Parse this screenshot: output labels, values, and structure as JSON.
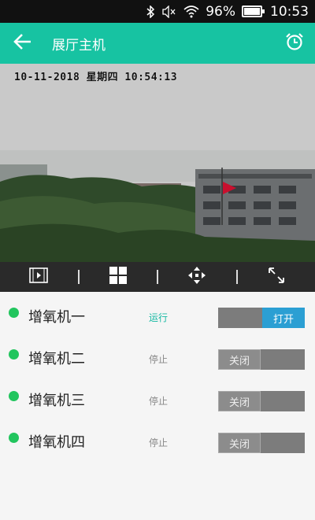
{
  "status_bar": {
    "battery": "96%",
    "time": "10:53",
    "icons": [
      "bluetooth-icon",
      "mute-icon",
      "wifi-icon",
      "battery-icon"
    ]
  },
  "app_bar": {
    "title": "展厅主机",
    "left_icon": "back-arrow-icon",
    "right_icon": "alarm-clock-icon",
    "background_color": "#17c3a2"
  },
  "camera": {
    "osd_text": "10-11-2018 星期四 10:54:13"
  },
  "toolbar": {
    "buttons": [
      "playback-icon",
      "grid-layout-icon",
      "ptz-direction-icon",
      "fullscreen-icon"
    ]
  },
  "devices": [
    {
      "name": "增氧机一",
      "status": "运行",
      "switch_label": "打开",
      "state": "on"
    },
    {
      "name": "增氧机二",
      "status": "停止",
      "switch_label": "关闭",
      "state": "off"
    },
    {
      "name": "增氧机三",
      "status": "停止",
      "switch_label": "关闭",
      "state": "off"
    },
    {
      "name": "增氧机四",
      "status": "停止",
      "switch_label": "关闭",
      "state": "off"
    }
  ],
  "colors": {
    "on_status": "#17b9a3",
    "switch_on": "#2b9fd3",
    "indicator": "#22c55e"
  }
}
